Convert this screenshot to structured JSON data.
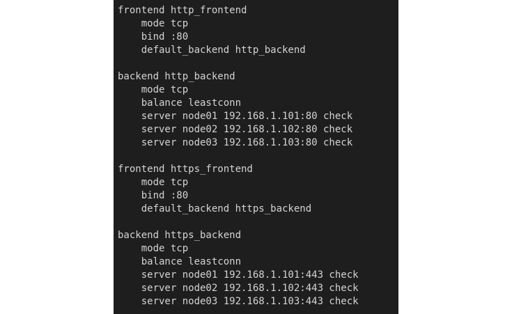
{
  "editor": {
    "background": "#1e1e1e",
    "text_color": "#d4d4d4",
    "lines": [
      "frontend http_frontend",
      "    mode tcp",
      "    bind :80",
      "    default_backend http_backend",
      "",
      "backend http_backend",
      "    mode tcp",
      "    balance leastconn",
      "    server node01 192.168.1.101:80 check",
      "    server node02 192.168.1.102:80 check",
      "    server node03 192.168.1.103:80 check",
      "",
      "frontend https_frontend",
      "    mode tcp",
      "    bind :80",
      "    default_backend https_backend",
      "",
      "backend https_backend",
      "    mode tcp",
      "    balance leastconn",
      "    server node01 192.168.1.101:443 check",
      "    server node02 192.168.1.102:443 check",
      "    server node03 192.168.1.103:443 check"
    ]
  }
}
